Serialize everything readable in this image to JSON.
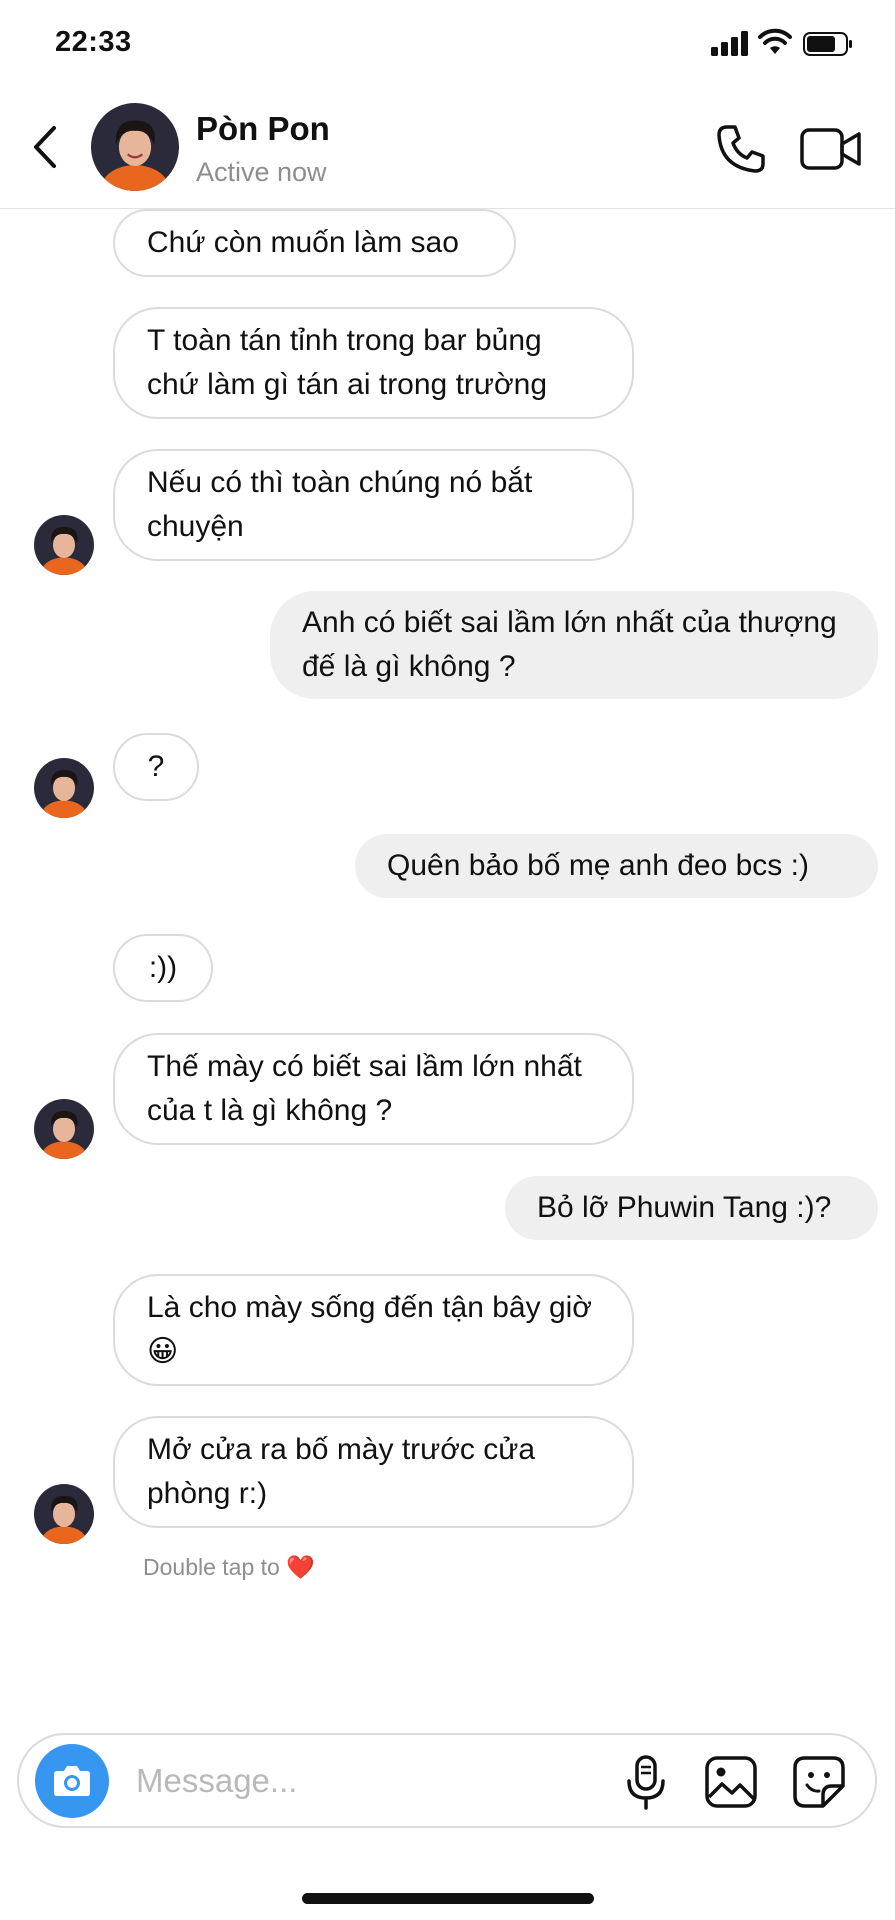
{
  "status_bar": {
    "time": "22:33"
  },
  "header": {
    "contact_name": "Pòn Pon",
    "contact_status": "Active now",
    "icons": {
      "back": "chevron-left-icon",
      "call": "phone-icon",
      "video": "video-camera-icon"
    }
  },
  "messages": [
    {
      "direction": "incoming",
      "text": "Chứ còn muốn làm sao"
    },
    {
      "direction": "incoming",
      "text": "T toàn tán tỉnh trong bar bủng chứ làm gì tán ai trong trường"
    },
    {
      "direction": "incoming",
      "text": "Nếu có thì toàn chúng nó bắt chuyện"
    },
    {
      "direction": "outgoing",
      "text": "Anh có biết sai lầm lớn nhất của thượng đế là gì không ?"
    },
    {
      "direction": "incoming",
      "text": "?"
    },
    {
      "direction": "outgoing",
      "text": "Quên bảo bố mẹ anh đeo bcs :)"
    },
    {
      "direction": "incoming",
      "text": ":))"
    },
    {
      "direction": "incoming",
      "text": "Thế mày có biết sai lầm lớn nhất của t là gì không ?"
    },
    {
      "direction": "outgoing",
      "text": "Bỏ lỡ Phuwin Tang :)?"
    },
    {
      "direction": "incoming",
      "text": "Là cho mày sống đến tận bây giờ 😀"
    },
    {
      "direction": "incoming",
      "text": "Mở cửa ra bố mày trước cửa phòng r:)"
    }
  ],
  "hint": {
    "text": "Double tap to",
    "emoji": "❤️"
  },
  "composer": {
    "placeholder": "Message...",
    "icons": {
      "camera": "camera-icon",
      "mic": "microphone-icon",
      "gallery": "image-gallery-icon",
      "sticker": "sticker-icon"
    }
  },
  "colors": {
    "camera_button": "#3797f0",
    "outgoing_bubble": "#efefef",
    "incoming_border": "#dbdbdb",
    "secondary_text": "#8e8e8e"
  }
}
